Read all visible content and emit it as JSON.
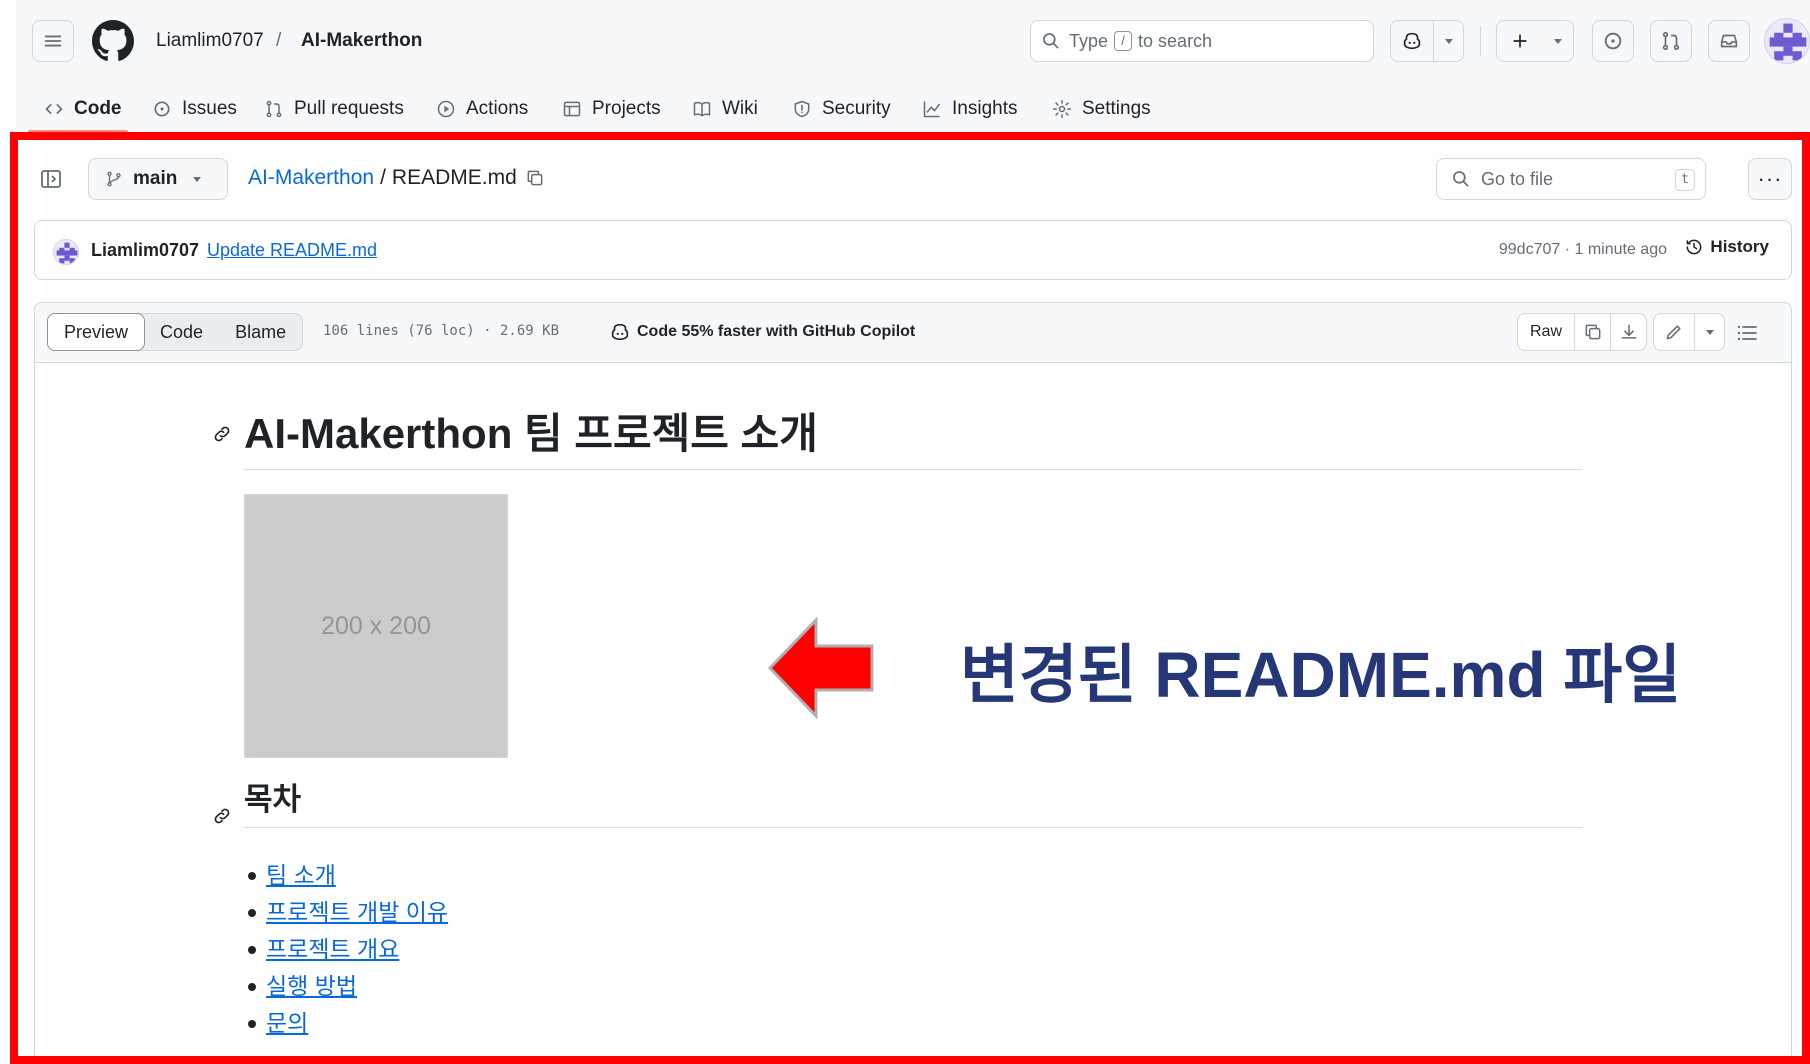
{
  "header": {
    "owner": "Liamlim0707",
    "separator": "/",
    "repo": "AI-Makerthon",
    "search": {
      "before": "Type",
      "key": "/",
      "after": "to search"
    }
  },
  "nav": {
    "items": [
      {
        "label": "Code",
        "icon": "code-icon",
        "active": true
      },
      {
        "label": "Issues",
        "icon": "issue-icon"
      },
      {
        "label": "Pull requests",
        "icon": "pull-request-icon"
      },
      {
        "label": "Actions",
        "icon": "play-icon"
      },
      {
        "label": "Projects",
        "icon": "table-icon"
      },
      {
        "label": "Wiki",
        "icon": "book-icon"
      },
      {
        "label": "Security",
        "icon": "shield-icon"
      },
      {
        "label": "Insights",
        "icon": "graph-icon"
      },
      {
        "label": "Settings",
        "icon": "gear-icon"
      }
    ]
  },
  "file_header": {
    "branch": "main",
    "repo_link": "AI-Makerthon",
    "separator": "/",
    "filename": "README.md",
    "goto_placeholder": "Go to file",
    "goto_key": "t",
    "more": "···"
  },
  "commit": {
    "user": "Liamlim0707",
    "message": "Update README.md",
    "meta": "99dc707 · 1 minute ago",
    "history": "History"
  },
  "file_toolbar": {
    "tabs": [
      "Preview",
      "Code",
      "Blame"
    ],
    "active_tab": "Preview",
    "info": "106 lines (76 loc) · 2.69 KB",
    "copilot": "Code 55% faster with GitHub Copilot",
    "raw": "Raw"
  },
  "readme": {
    "h1": "AI-Makerthon 팀 프로젝트 소개",
    "image_placeholder": "200 x 200",
    "h2": "목차",
    "toc": [
      "팀 소개",
      "프로젝트 개발 이유",
      "프로젝트 개요",
      "실행 방법",
      "문의"
    ]
  },
  "annotation": {
    "text": "변경된 README.md 파일",
    "color": "#263777",
    "arrow_color": "#ff0000"
  }
}
